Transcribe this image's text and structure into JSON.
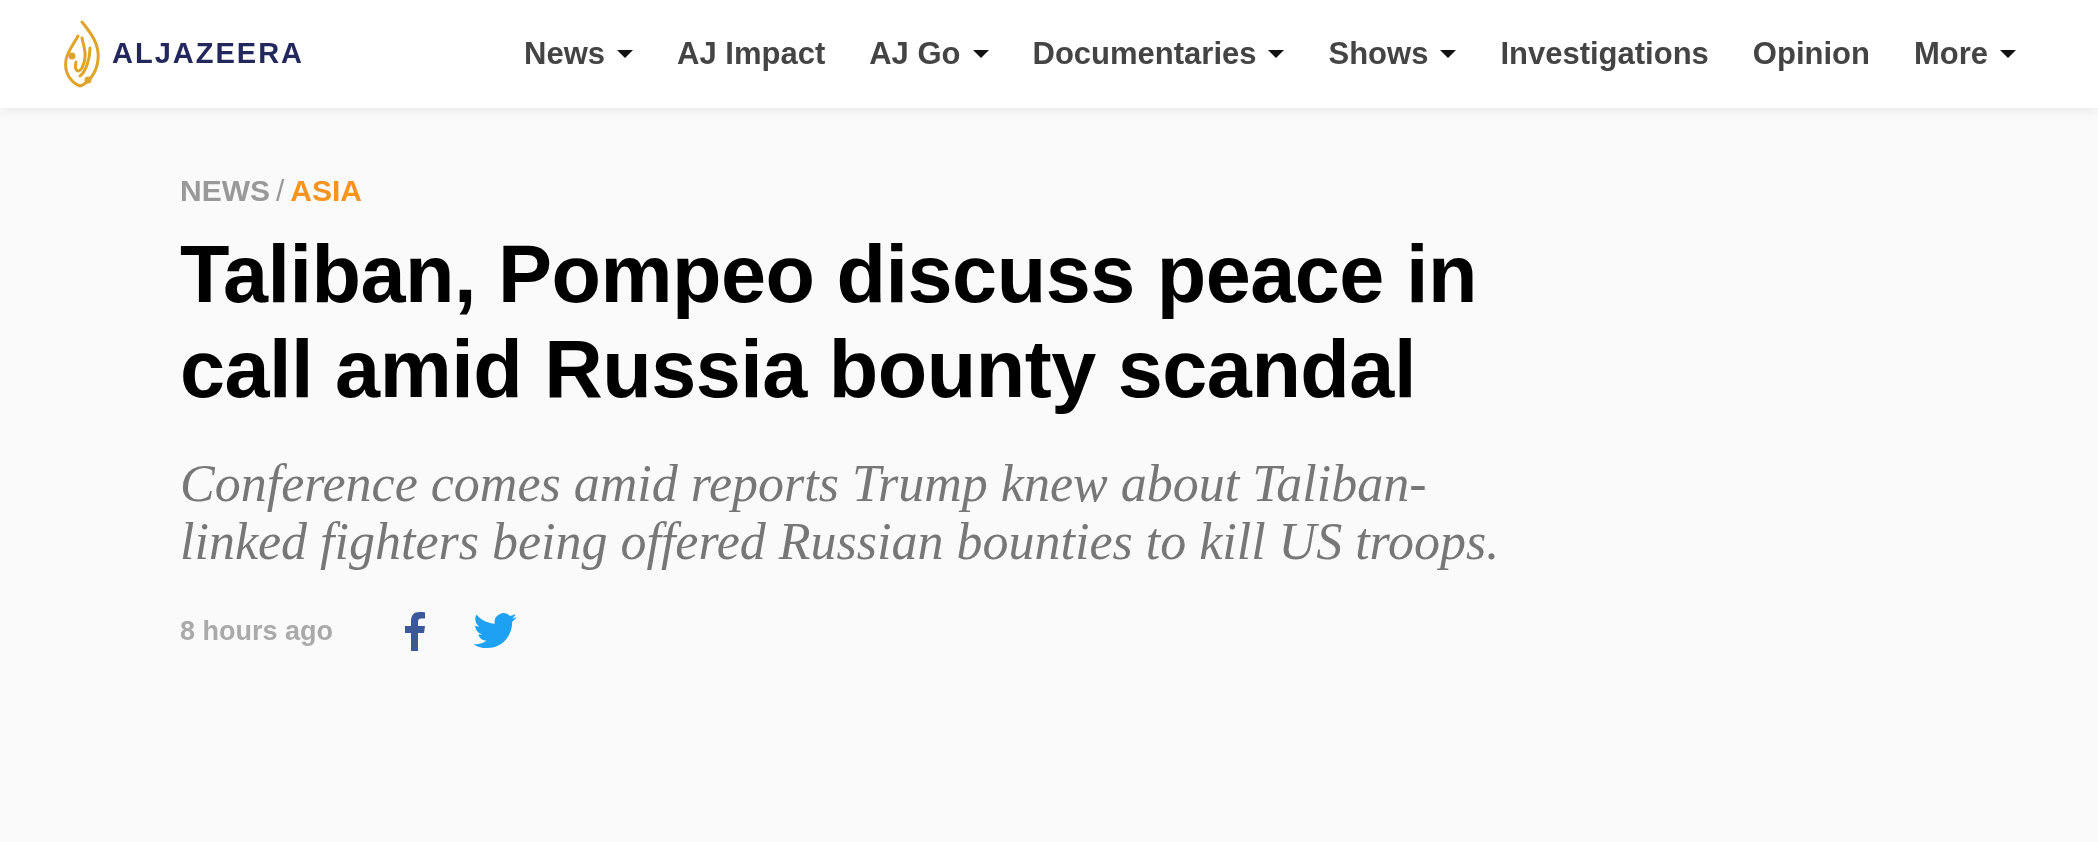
{
  "logo": {
    "text": "ALJAZEERA"
  },
  "nav": [
    {
      "label": "News",
      "dropdown": true
    },
    {
      "label": "AJ Impact",
      "dropdown": false
    },
    {
      "label": "AJ Go",
      "dropdown": true
    },
    {
      "label": "Documentaries",
      "dropdown": true
    },
    {
      "label": "Shows",
      "dropdown": true
    },
    {
      "label": "Investigations",
      "dropdown": false
    },
    {
      "label": "Opinion",
      "dropdown": false
    },
    {
      "label": "More",
      "dropdown": true
    }
  ],
  "breadcrumb": {
    "section": "NEWS",
    "separator": "/",
    "topic": "ASIA"
  },
  "headline": "Taliban, Pompeo discuss peace in call amid Russia bounty scandal",
  "summary": "Conference comes amid reports Trump knew about Taliban-linked fighters being offered Russian bounties to kill US troops.",
  "timestamp": "8 hours ago"
}
